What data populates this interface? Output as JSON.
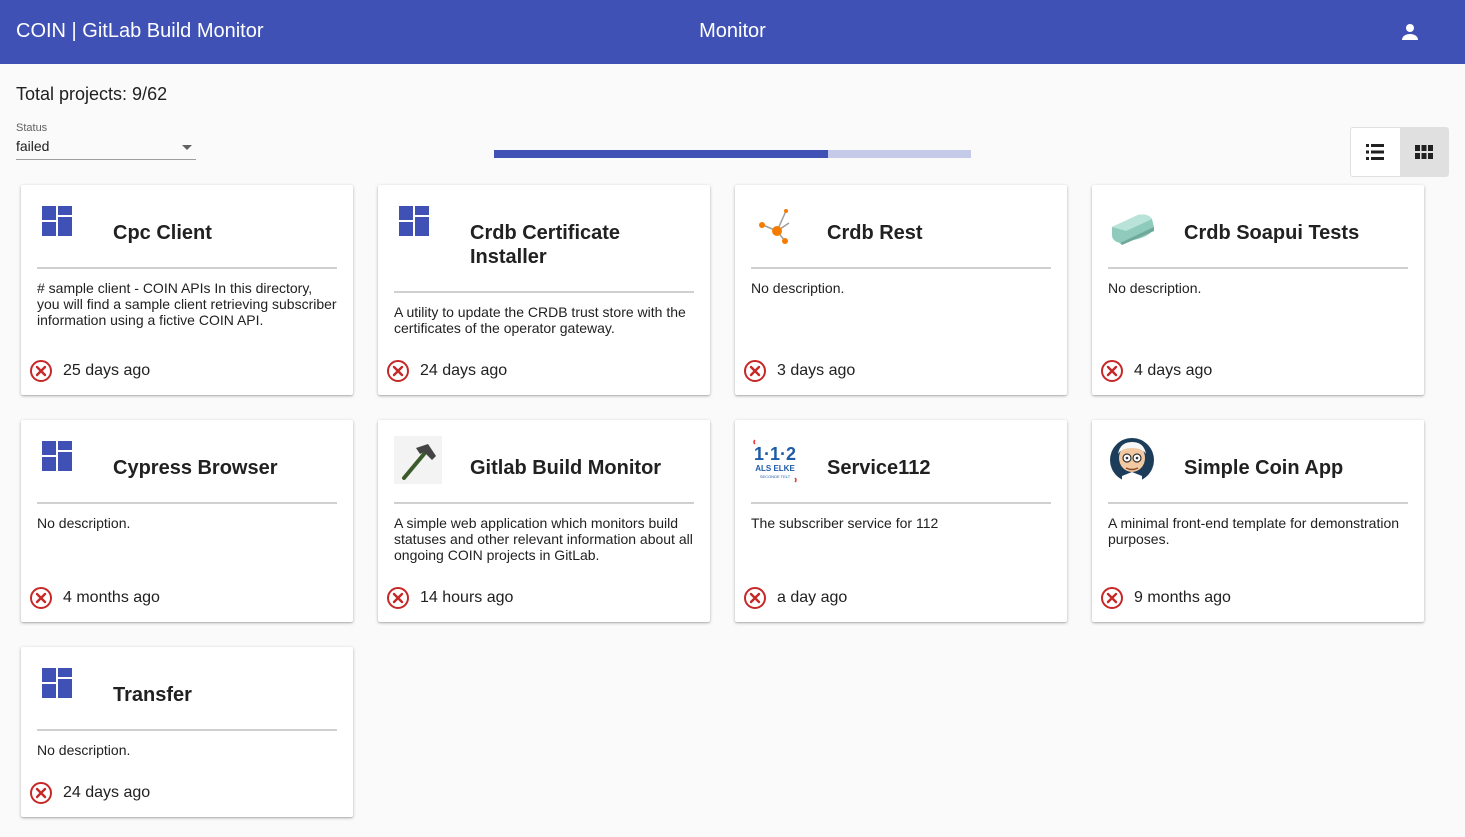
{
  "header": {
    "app_title": "COIN | GitLab Build Monitor",
    "center_title": "Monitor",
    "account_icon": "account-icon"
  },
  "summary": {
    "total_label": "Total projects: 9/62"
  },
  "filter": {
    "label": "Status",
    "value": "failed"
  },
  "progress": {
    "value_percent": 70
  },
  "view_toggle": {
    "list_icon": "list-view-icon",
    "grid_icon": "grid-view-icon",
    "active": "grid"
  },
  "colors": {
    "primary": "#3f51b5",
    "failed": "#c62828"
  },
  "projects": [
    {
      "name": "Cpc Client",
      "description": "# sample client - COIN APIs  In this directory, you will find a sample client retrieving subscriber information using a fictive COIN API.",
      "time": "25 days ago",
      "icon": "default-project-icon"
    },
    {
      "name": "Crdb Certificate Installer",
      "description": "A utility to update the CRDB trust store with the certificates of the operator gateway.",
      "time": "24 days ago",
      "icon": "default-project-icon"
    },
    {
      "name": "Crdb Rest",
      "description": "No description.",
      "time": "3 days ago",
      "icon": "network-nodes-icon"
    },
    {
      "name": "Crdb Soapui Tests",
      "description": "No description.",
      "time": "4 days ago",
      "icon": "soap-bar-icon"
    },
    {
      "name": "Cypress Browser",
      "description": "No description.",
      "time": "4 months ago",
      "icon": "default-project-icon"
    },
    {
      "name": "Gitlab Build Monitor",
      "description": "A simple web application which monitors build statuses and other relevant information about all ongoing COIN projects in GitLab.",
      "time": "14 hours ago",
      "icon": "hammer-icon"
    },
    {
      "name": "Service112",
      "description": "The subscriber service for 112",
      "time": "a day ago",
      "icon": "service112-logo-icon",
      "logo_text": "1·1·2",
      "logo_subtext": "ALS ELKE",
      "logo_subtext2": "SECONDE TELT"
    },
    {
      "name": "Simple Coin App",
      "description": "A minimal front-end template for demonstration purposes.",
      "time": "9 months ago",
      "icon": "professor-avatar-icon"
    },
    {
      "name": "Transfer",
      "description": "No description.",
      "time": "24 days ago",
      "icon": "default-project-icon"
    }
  ]
}
